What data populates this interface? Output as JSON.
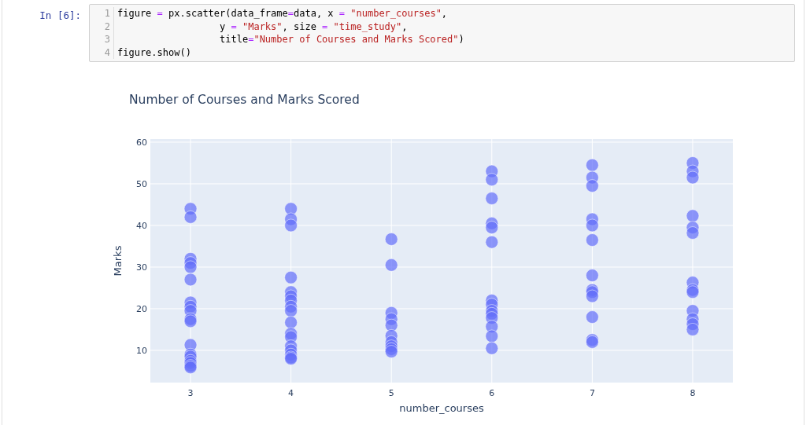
{
  "cell": {
    "prompt": "In [6]:",
    "lines": [
      {
        "number": "1",
        "segments": [
          {
            "kind": "plain",
            "text": "figure "
          },
          {
            "kind": "op",
            "text": "="
          },
          {
            "kind": "plain",
            "text": " px.scatter(data_frame"
          },
          {
            "kind": "op",
            "text": "="
          },
          {
            "kind": "plain",
            "text": "data, x "
          },
          {
            "kind": "op",
            "text": "="
          },
          {
            "kind": "string",
            "text": " \"number_courses\""
          },
          {
            "kind": "plain",
            "text": ","
          }
        ]
      },
      {
        "number": "2",
        "segments": [
          {
            "kind": "plain",
            "text": "                  y "
          },
          {
            "kind": "op",
            "text": "="
          },
          {
            "kind": "string",
            "text": " \"Marks\""
          },
          {
            "kind": "plain",
            "text": ", size "
          },
          {
            "kind": "op",
            "text": "="
          },
          {
            "kind": "string",
            "text": " \"time_study\""
          },
          {
            "kind": "plain",
            "text": ","
          }
        ]
      },
      {
        "number": "3",
        "segments": [
          {
            "kind": "plain",
            "text": "                  title"
          },
          {
            "kind": "op",
            "text": "="
          },
          {
            "kind": "string",
            "text": "\"Number of Courses and Marks Scored\""
          },
          {
            "kind": "plain",
            "text": ")"
          }
        ]
      },
      {
        "number": "4",
        "segments": [
          {
            "kind": "plain",
            "text": "figure.show()"
          }
        ]
      }
    ]
  },
  "output": {
    "chart_data": {
      "type": "scatter",
      "title": "Number of Courses and Marks Scored",
      "xlabel": "number_courses",
      "ylabel": "Marks",
      "grid": true,
      "xlim": [
        2.6,
        8.4
      ],
      "ylim": [
        2.26,
        60.75
      ],
      "xticks": [
        3,
        4,
        5,
        6,
        7,
        8
      ],
      "yticks": [
        10,
        20,
        30,
        40,
        50,
        60
      ],
      "series": [
        {
          "color": "#636efa",
          "x": [
            3,
            3,
            3,
            3,
            3,
            3,
            3,
            3,
            3,
            3,
            3,
            3,
            3,
            3,
            3,
            3,
            3,
            3,
            4,
            4,
            4,
            4,
            4,
            4,
            4,
            4,
            4,
            4,
            4,
            4,
            4,
            4,
            4,
            4,
            4,
            5,
            5,
            5,
            5,
            5,
            5,
            5,
            5,
            5,
            5,
            6,
            6,
            6,
            6,
            6,
            6,
            6,
            6,
            6,
            6,
            6,
            6,
            6,
            6,
            7,
            7,
            7,
            7,
            7,
            7,
            7,
            7,
            7,
            7,
            7,
            7,
            7,
            8,
            8,
            8,
            8,
            8,
            8,
            8,
            8,
            8,
            8,
            8,
            8,
            8
          ],
          "values": [
            44,
            42,
            32,
            31,
            30,
            27,
            21.5,
            20.5,
            19.5,
            17.5,
            17,
            11.3,
            9,
            8.5,
            7.5,
            7,
            6.3,
            5.9,
            44,
            41.5,
            40,
            27.5,
            24,
            23,
            22,
            20.5,
            19.5,
            16.7,
            14,
            13.2,
            11,
            10,
            9,
            8.3,
            8,
            36.7,
            30.5,
            19,
            17.5,
            16,
            13.5,
            12,
            11,
            10.3,
            9.7,
            53,
            51,
            46.5,
            40.5,
            39.5,
            36,
            22,
            21,
            19.5,
            18.8,
            17.8,
            15.7,
            13.4,
            10.5,
            54.5,
            51.5,
            49.5,
            41.5,
            40,
            36.5,
            28,
            24.5,
            24,
            23,
            18,
            12.5,
            12,
            55,
            53,
            51.5,
            42.3,
            39.5,
            38.2,
            26.3,
            24.5,
            24,
            19.5,
            17.5,
            16.3,
            15
          ]
        }
      ]
    }
  }
}
